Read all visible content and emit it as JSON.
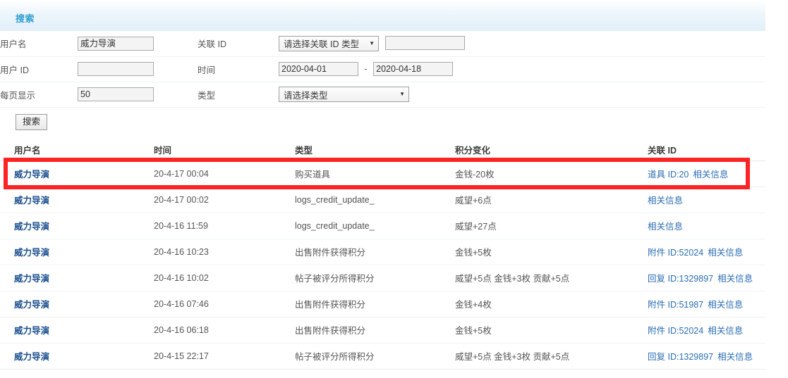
{
  "search": {
    "panel_title": "搜索",
    "fields": {
      "username_label": "用户名",
      "username_value": "威力导演",
      "userid_label": "用户 ID",
      "userid_value": "",
      "perpage_label": "每页显示",
      "perpage_value": "50",
      "assoc_label": "关联 ID",
      "assoc_select_value": "请选择关联 ID 类型",
      "assoc_input_value": "",
      "time_label": "时间",
      "time_start": "2020-04-01",
      "time_end": "2020-04-18",
      "time_separator": "-",
      "type_label": "类型",
      "type_select_value": "请选择类型"
    },
    "submit_label": "搜索"
  },
  "results": {
    "columns": [
      "用户名",
      "时间",
      "类型",
      "积分变化",
      "关联 ID"
    ],
    "related_link_label": "相关信息",
    "rows": [
      {
        "user": "威力导演",
        "time": "20-4-17 00:04",
        "type": "购买道具",
        "delta": "金钱-20枚",
        "assoc_id": "道具 ID:20",
        "related": "相关信息",
        "highlighted": true
      },
      {
        "user": "威力导演",
        "time": "20-4-17 00:02",
        "type": "logs_credit_update_",
        "delta": "威望+6点",
        "assoc_id": "",
        "related": "相关信息",
        "highlighted": false
      },
      {
        "user": "威力导演",
        "time": "20-4-16 11:59",
        "type": "logs_credit_update_",
        "delta": "威望+27点",
        "assoc_id": "",
        "related": "相关信息",
        "highlighted": false
      },
      {
        "user": "威力导演",
        "time": "20-4-16 10:23",
        "type": "出售附件获得积分",
        "delta": "金钱+5枚",
        "assoc_id": "附件 ID:52024",
        "related": "相关信息",
        "highlighted": false
      },
      {
        "user": "威力导演",
        "time": "20-4-16 10:02",
        "type": "帖子被评分所得积分",
        "delta": "威望+5点 金钱+3枚 贡献+5点",
        "assoc_id": "回复 ID:1329897",
        "related": "相关信息",
        "highlighted": false
      },
      {
        "user": "威力导演",
        "time": "20-4-16 07:46",
        "type": "出售附件获得积分",
        "delta": "金钱+4枚",
        "assoc_id": "附件 ID:51987",
        "related": "相关信息",
        "highlighted": false
      },
      {
        "user": "威力导演",
        "time": "20-4-16 06:18",
        "type": "出售附件获得积分",
        "delta": "金钱+5枚",
        "assoc_id": "附件 ID:52024",
        "related": "相关信息",
        "highlighted": false
      },
      {
        "user": "威力导演",
        "time": "20-4-15 22:17",
        "type": "帖子被评分所得积分",
        "delta": "威望+5点 金钱+3枚 贡献+5点",
        "assoc_id": "回复 ID:1329897",
        "related": "相关信息",
        "highlighted": false
      }
    ]
  },
  "annotation": {
    "highlight_color": "#fb2323",
    "highlight_row_index": 0
  },
  "colors": {
    "panel_accent": "#2f9fd0",
    "user_link": "#1a4f8f",
    "related_link": "#2b6eb3"
  },
  "icons": {
    "select_caret": "▼"
  }
}
